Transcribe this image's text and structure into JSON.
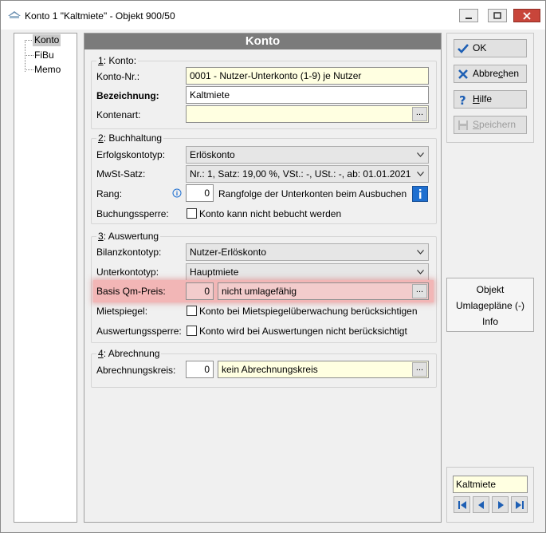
{
  "window": {
    "title": "Konto 1 \"Kaltmiete\" - Objekt 900/50"
  },
  "colors": {
    "highlight": "#f2b6b6",
    "info_blue": "#1e6fd0",
    "header_gray": "#7b7b7b",
    "close_red": "#c8453a"
  },
  "tree": {
    "items": [
      "Konto",
      "FiBu",
      "Memo"
    ],
    "selected": "Konto"
  },
  "header": {
    "title": "Konto"
  },
  "konto": {
    "group_num": "1",
    "group_rest": ": Konto:",
    "kontonr_label": "Konto-Nr.:",
    "kontonr_value": "0001 - Nutzer-Unterkonto (1-9) je Nutzer",
    "bezeichnung_label": "Bezeichnung:",
    "bezeichnung_value": "Kaltmiete",
    "kontenart_label": "Kontenart:",
    "kontenart_value": "",
    "dots": "..."
  },
  "buchhaltung": {
    "group_num": "2",
    "group_rest": ": Buchhaltung",
    "erfolg_label": "Erfolgskontotyp:",
    "erfolg_value": "Erlöskonto",
    "mwst_label": "MwSt-Satz:",
    "mwst_value": "Nr.: 1,  Satz: 19,00 %,  VSt.: -,  USt.: -,  ab: 01.01.2021",
    "rang_label": "Rang:",
    "rang_value": "0",
    "rang_text": "Rangfolge der Unterkonten beim Ausbuchen",
    "sperre_label": "Buchungssperre:",
    "sperre_text": "Konto kann nicht bebucht werden"
  },
  "auswertung": {
    "group_num": "3",
    "group_rest": ": Auswertung",
    "bilanz_label": "Bilanzkontotyp:",
    "bilanz_value": "Nutzer-Erlöskonto",
    "unterkonto_label": "Unterkontotyp:",
    "unterkonto_value": "Hauptmiete",
    "qm_label": "Basis Qm-Preis:",
    "qm_value": "0",
    "qm_text": "nicht umlagefähig",
    "mietspiegel_label": "Mietspiegel:",
    "mietspiegel_text": "Konto bei Mietspiegelüberwachung berücksichtigen",
    "ausw_sperre_label": "Auswertungssperre:",
    "ausw_sperre_text": "Konto wird bei Auswertungen nicht berücksichtigt"
  },
  "abrechnung": {
    "group_num": "4",
    "group_rest": ": Abrechnung",
    "kreis_label": "Abrechnungskreis:",
    "kreis_value": "0",
    "kreis_text": "kein Abrechnungskreis"
  },
  "buttons": {
    "ok": "OK",
    "abbrechen_pre": "Abbre",
    "abbrechen_u": "c",
    "abbrechen_post": "hen",
    "hilfe_u": "H",
    "hilfe_post": "ilfe",
    "speichern_u": "S",
    "speichern_post": "peichern"
  },
  "side": {
    "objekt": "Objekt",
    "umlage": "Umlagepläne (-)",
    "info": "Info"
  },
  "nav": {
    "current": "Kaltmiete"
  }
}
